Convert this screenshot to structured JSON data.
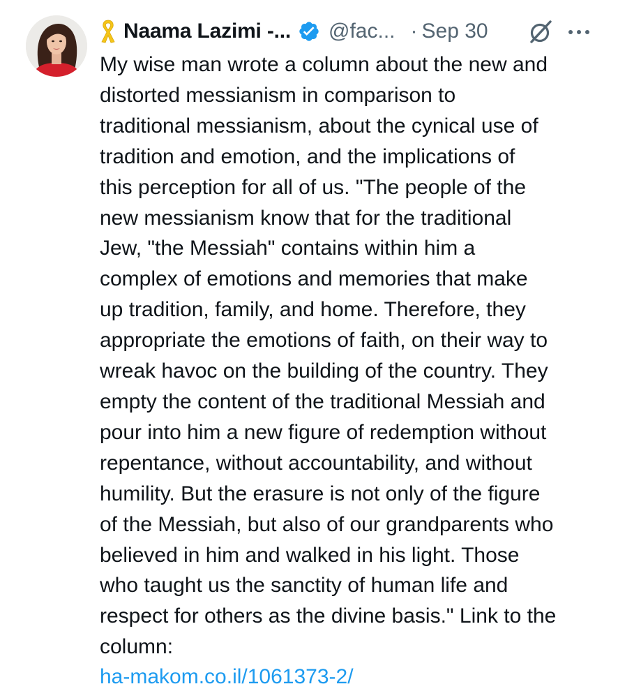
{
  "tweet": {
    "author": {
      "display_name": "Naama Lazimi -...",
      "handle": "@fac...",
      "badge_icon": "yellow-ribbon-icon",
      "verified_icon": "verified-badge-icon",
      "avatar": "avatar"
    },
    "separator": "·",
    "date": "Sep 30",
    "actions": {
      "grok_icon": "grok-icon",
      "more_icon": "more-icon"
    },
    "text": "My wise man wrote a column about the new and\ndistorted messianism in comparison to\ntraditional messianism, about the cynical use of\ntradition and emotion, and the implications of\nthis perception for all of us. \"The people of the\nnew messianism know that for the traditional\nJew, \"the Messiah\" contains within him a\ncomplex of emotions and memories that make\nup tradition, family, and home. Therefore, they\nappropriate the emotions of faith, on their way to\nwreak havoc on the building of the country. They\nempty the content of the traditional Messiah and\npour into him a new figure of redemption without\nrepentance, without accountability, and without\nhumility. But the erasure is not only of the figure\nof the Messiah, but also of our grandparents who\nbelieved in him and walked in his light. Those\nwho taught us the sanctity of human life and\nrespect for others as the divine basis.\" Link to the\ncolumn:",
    "link": "ha-makom.co.il/1061373-2/"
  },
  "colors": {
    "text": "#0f1419",
    "secondary": "#536471",
    "link": "#1d9bf0",
    "verified": "#1d9bf0",
    "ribbon": "#f5c518"
  }
}
